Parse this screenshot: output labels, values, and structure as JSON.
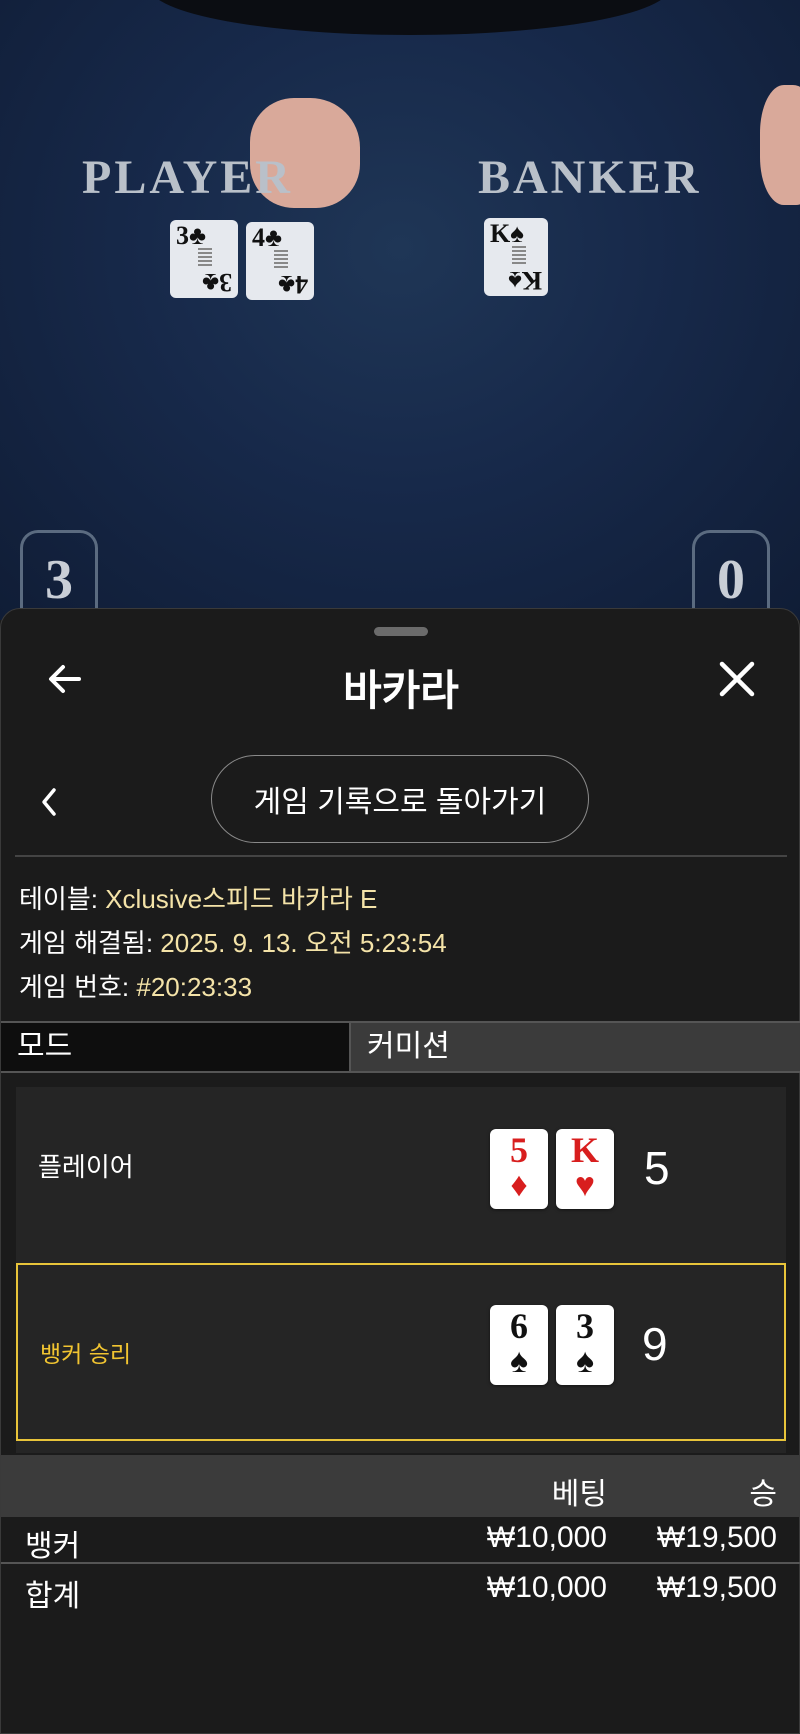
{
  "video": {
    "player_label": "PLAYER",
    "banker_label": "BANKER",
    "player_cards": [
      {
        "rank": "3",
        "suit": "♣"
      },
      {
        "rank": "4",
        "suit": "♣"
      }
    ],
    "banker_cards": [
      {
        "rank": "K",
        "suit": "♠"
      }
    ],
    "player_score": "3",
    "banker_score": "0"
  },
  "sheet": {
    "title": "바카라",
    "history_button": "게임 기록으로 돌아가기"
  },
  "info": {
    "table_key": "테이블: ",
    "table_val": "Xclusive스피드 바카라 E",
    "resolved_key": "게임 해결됨: ",
    "resolved_val": "2025. 9. 13. 오전 5:23:54",
    "number_key": "게임 번호: ",
    "number_val": "#20:23:33"
  },
  "mode": {
    "key": "모드",
    "value": "커미션"
  },
  "results": {
    "player": {
      "label": "플레이어",
      "cards": [
        {
          "rank": "5",
          "suit": "♦",
          "color": "red"
        },
        {
          "rank": "K",
          "suit": "♥",
          "color": "red"
        }
      ],
      "total": "5"
    },
    "banker": {
      "label": "뱅커 승리",
      "cards": [
        {
          "rank": "6",
          "suit": "♠",
          "color": "black"
        },
        {
          "rank": "3",
          "suit": "♠",
          "color": "black"
        }
      ],
      "total": "9"
    }
  },
  "bets": {
    "header": {
      "bet": "베팅",
      "win": "승"
    },
    "rows": [
      {
        "name": "뱅커",
        "bet": "₩10,000",
        "win": "₩19,500"
      },
      {
        "name": "합계",
        "bet": "₩10,000",
        "win": "₩19,500"
      }
    ]
  },
  "colors": {
    "accent_gold": "#f2c531",
    "info_value": "#f4e3a8",
    "sheet_bg": "#1b1b1b"
  }
}
